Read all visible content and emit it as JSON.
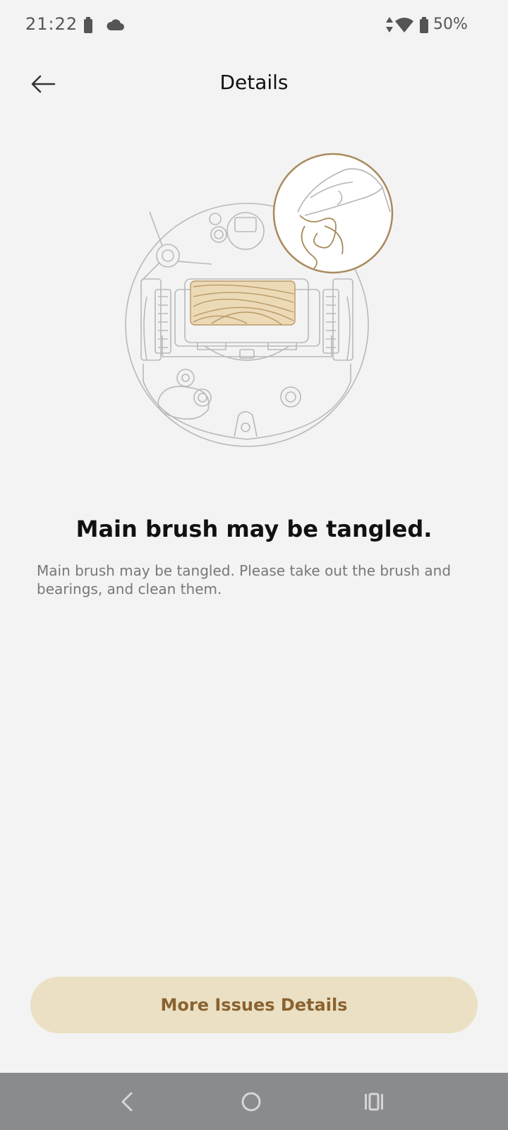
{
  "status_bar": {
    "time": "21:22",
    "battery_percent": "50%",
    "icons": [
      "battery-icon",
      "cloud-icon",
      "data-arrows-icon",
      "wifi-icon",
      "battery-icon"
    ]
  },
  "header": {
    "back_icon": "arrow-left-icon",
    "title": "Details"
  },
  "illustration": {
    "subject": "robot-vacuum-underside",
    "accent_color": "#a88a5c"
  },
  "main": {
    "issue_title": "Main brush may be tangled.",
    "issue_description": "Main brush may be tangled. Please take out the brush and bearings, and clean them."
  },
  "footer": {
    "more_issues_label": "More Issues Details",
    "button_bg": "#ebe0c4",
    "button_text_color": "#8a6230"
  },
  "nav_bar": {
    "buttons": [
      "back-icon",
      "home-icon",
      "recents-icon"
    ],
    "background": "#8a8b8e"
  }
}
